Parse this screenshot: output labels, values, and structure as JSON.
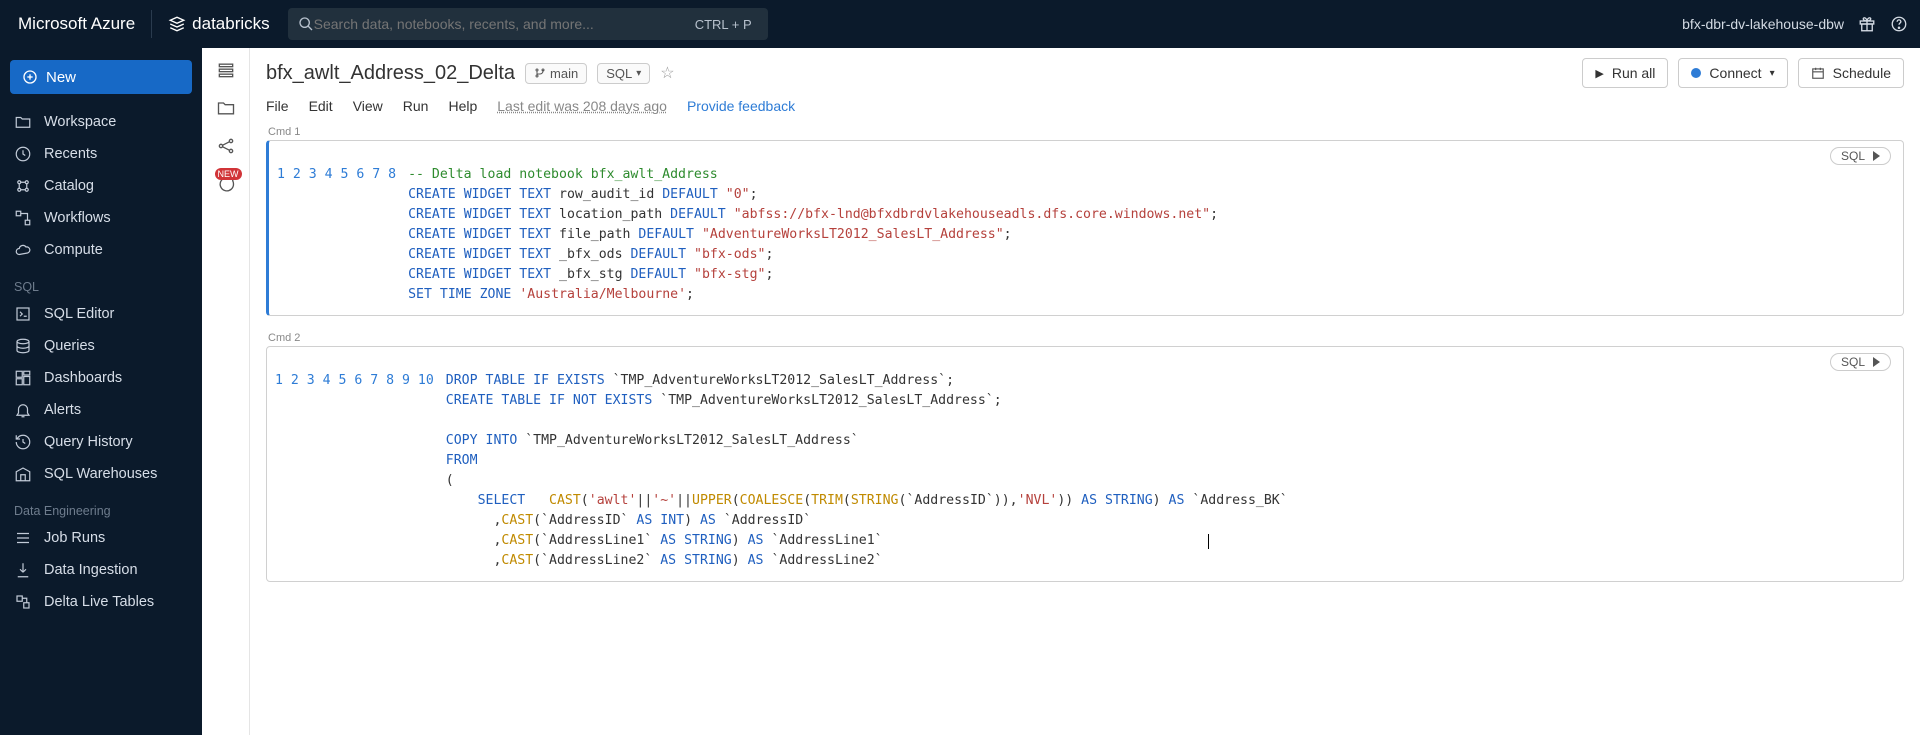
{
  "topbar": {
    "azure": "Microsoft Azure",
    "databricks": "databricks",
    "search_placeholder": "Search data, notebooks, recents, and more...",
    "shortcut": "CTRL + P",
    "workspace_name": "bfx-dbr-dv-lakehouse-dbw"
  },
  "leftnav": {
    "new": "New",
    "items_top": [
      "Workspace",
      "Recents",
      "Catalog",
      "Workflows",
      "Compute"
    ],
    "section_sql": "SQL",
    "items_sql": [
      "SQL Editor",
      "Queries",
      "Dashboards",
      "Alerts",
      "Query History",
      "SQL Warehouses"
    ],
    "section_de": "Data Engineering",
    "items_de": [
      "Job Runs",
      "Data Ingestion",
      "Delta Live Tables"
    ]
  },
  "rail": {
    "new_badge": "NEW"
  },
  "doc": {
    "title": "bfx_awlt_Address_02_Delta",
    "branch": "main",
    "lang": "SQL",
    "run_all": "Run all",
    "connect": "Connect",
    "schedule": "Schedule",
    "menu": [
      "File",
      "Edit",
      "View",
      "Run",
      "Help"
    ],
    "last_edit": "Last edit was 208 days ago",
    "feedback": "Provide feedback"
  },
  "cells": {
    "cmd1_label": "Cmd  1",
    "cmd2_label": "Cmd  2",
    "lang_pill": "SQL"
  },
  "tokens": {
    "t": {
      "dash2": "-- ",
      "deltaComment": "Delta load notebook bfx_awlt_Address",
      "CREATE": "CREATE",
      "WIDGET": "WIDGET",
      "TEXT": "TEXT",
      "DEFAULT": "DEFAULT",
      "SET": "SET",
      "TIME": "TIME",
      "ZONE": "ZONE",
      "DROP": "DROP",
      "TABLE": "TABLE",
      "IF": "IF",
      "EXISTS": "EXISTS",
      "NOT": "NOT",
      "COPY": "COPY",
      "INTO": "INTO",
      "FROM": "FROM",
      "SELECT": "SELECT",
      "AS": "AS",
      "CAST": "CAST",
      "UPPER": "UPPER",
      "COALESCE": "COALESCE",
      "TRIM": "TRIM",
      "STRINGfn": "STRING",
      "STRINGty": "STRING",
      "INT": "INT",
      "row_audit_id": "row_audit_id",
      "location_path": "location_path",
      "file_path": "file_path",
      "_bfx_ods": "_bfx_ods",
      "_bfx_stg": "_bfx_stg",
      "zero": "\"0\"",
      "abfss": "\"abfss://bfx-lnd@bfxdbrdvlakehouseadls.dfs.core.windows.net\"",
      "advfile": "\"AdventureWorksLT2012_SalesLT_Address\"",
      "bfxods": "\"bfx-ods\"",
      "bfxstg": "\"bfx-stg\"",
      "melb": "'Australia/Melbourne'",
      "semi": ";",
      "tmpTbl": "`TMP_AdventureWorksLT2012_SalesLT_Address`",
      "paren_open": "(",
      "paren_close": ")",
      "awlt": "'awlt'",
      "pipe": "||",
      "tilde": "'~'",
      "addrID": "`AddressID`",
      "NVL": "'NVL'",
      "addrBK": "`Address_BK`",
      "addrIDout": "`AddressID`",
      "addrL1": "`AddressLine1`",
      "addrL2": "`AddressLine2`",
      "comma": ","
    }
  },
  "chart_data": null
}
